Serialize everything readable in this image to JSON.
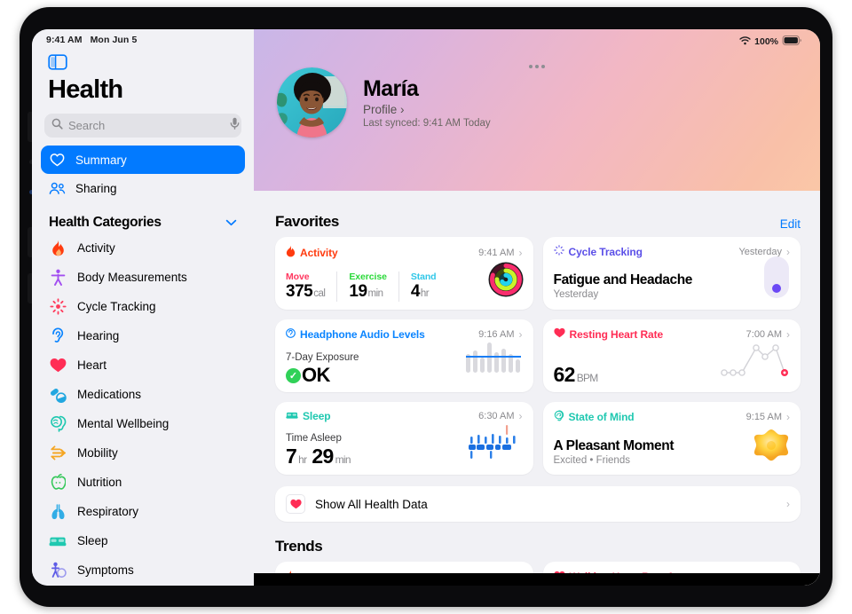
{
  "status_bar": {
    "time": "9:41 AM",
    "date": "Mon Jun 5",
    "battery_percent": "100%",
    "wifi_icon": "wifi-icon",
    "battery_icon": "battery-full-icon"
  },
  "sidebar": {
    "toggle_icon": "sidebar-toggle-icon",
    "app_title": "Health",
    "search": {
      "placeholder": "Search",
      "value": "",
      "icon": "search-icon",
      "mic_icon": "microphone-icon"
    },
    "nav": [
      {
        "label": "Summary",
        "icon": "heart-outline-icon",
        "selected": true
      },
      {
        "label": "Sharing",
        "icon": "two-people-icon",
        "selected": false
      }
    ],
    "categories_header": {
      "label": "Health Categories",
      "chevron_icon": "chevron-down-icon"
    },
    "categories": [
      {
        "label": "Activity",
        "icon": "flame-icon",
        "color": "#ff3b0f"
      },
      {
        "label": "Body Measurements",
        "icon": "body-figure-icon",
        "color": "#a24ff0"
      },
      {
        "label": "Cycle Tracking",
        "icon": "cycle-dots-icon",
        "color": "#ff3b5c"
      },
      {
        "label": "Hearing",
        "icon": "ear-icon",
        "color": "#0a84ff"
      },
      {
        "label": "Heart",
        "icon": "heart-filled-icon",
        "color": "#ff2d55"
      },
      {
        "label": "Medications",
        "icon": "pills-icon",
        "color": "#22a7e0"
      },
      {
        "label": "Mental Wellbeing",
        "icon": "head-brain-icon",
        "color": "#1fc8b0"
      },
      {
        "label": "Mobility",
        "icon": "arrows-icon",
        "color": "#f5a623"
      },
      {
        "label": "Nutrition",
        "icon": "apple-icon",
        "color": "#34c759"
      },
      {
        "label": "Respiratory",
        "icon": "lungs-icon",
        "color": "#32ade6"
      },
      {
        "label": "Sleep",
        "icon": "bed-icon",
        "color": "#1fc8b0"
      },
      {
        "label": "Symptoms",
        "icon": "person-symptom-icon",
        "color": "#5e5ce6"
      }
    ]
  },
  "main": {
    "multitask_icon": "multitask-dots-icon",
    "profile": {
      "avatar_alt": "user-avatar",
      "name": "María",
      "link_label": "Profile",
      "link_chevron": "chevron-right-icon",
      "last_synced": "Last synced: 9:41 AM Today"
    },
    "favorites": {
      "title": "Favorites",
      "edit_label": "Edit",
      "cards": [
        {
          "id": "activity",
          "title": "Activity",
          "icon": "flame-icon",
          "color": "#ff3b0f",
          "time": "9:41 AM",
          "metrics": [
            {
              "label": "Move",
              "label_color": "#ff375f",
              "value": "375",
              "unit": "cal"
            },
            {
              "label": "Exercise",
              "label_color": "#2bd93a",
              "value": "19",
              "unit": "min"
            },
            {
              "label": "Stand",
              "label_color": "#30c7e8",
              "value": "4",
              "unit": "hr"
            }
          ],
          "art": "activity-rings"
        },
        {
          "id": "cycle-tracking",
          "title": "Cycle Tracking",
          "icon": "cycle-dots-icon",
          "color": "#5b4fe8",
          "time": "Yesterday",
          "headline": "Fatigue and Headache",
          "subline": "Yesterday",
          "art": "cycle-capsule"
        },
        {
          "id": "headphone-audio-levels",
          "title": "Headphone Audio Levels",
          "icon": "headphone-ear-icon",
          "color": "#0a84ff",
          "time": "9:16 AM",
          "small_label": "7-Day Exposure",
          "status_text": "OK",
          "status_icon": "check-circle-icon",
          "art": "audio-bars"
        },
        {
          "id": "resting-heart-rate",
          "title": "Resting Heart Rate",
          "icon": "heart-filled-icon",
          "color": "#ff2d55",
          "time": "7:00 AM",
          "value": "62",
          "unit": "BPM",
          "art": "heart-rate-line"
        },
        {
          "id": "sleep",
          "title": "Sleep",
          "icon": "bed-icon",
          "color": "#1fc8b0",
          "time": "6:30 AM",
          "small_label": "Time Asleep",
          "value_hours": "7",
          "unit_hours": "hr",
          "value_minutes": "29",
          "unit_minutes": "min",
          "art": "sleep-bars"
        },
        {
          "id": "state-of-mind",
          "title": "State of Mind",
          "icon": "head-swirl-icon",
          "color": "#1fc8b0",
          "time": "9:15 AM",
          "headline": "A Pleasant Moment",
          "subline": "Excited • Friends",
          "art": "star-blob"
        }
      ]
    },
    "show_all_row": {
      "label": "Show All Health Data",
      "icon": "heart-filled-icon",
      "chevron": "chevron-right-icon"
    },
    "trends": {
      "title": "Trends",
      "cards": [
        {
          "title": "Exercise Minutes",
          "icon": "flame-icon",
          "color": "#ff3b0f"
        },
        {
          "title": "Walking Heart Rate Average",
          "icon": "heart-filled-icon",
          "color": "#ff2d55"
        }
      ]
    }
  },
  "colors": {
    "accent_blue": "#027aff",
    "sheet_bg": "#f1f1f5",
    "card_bg": "#ffffff",
    "secondary_text": "#8a8a8e"
  }
}
